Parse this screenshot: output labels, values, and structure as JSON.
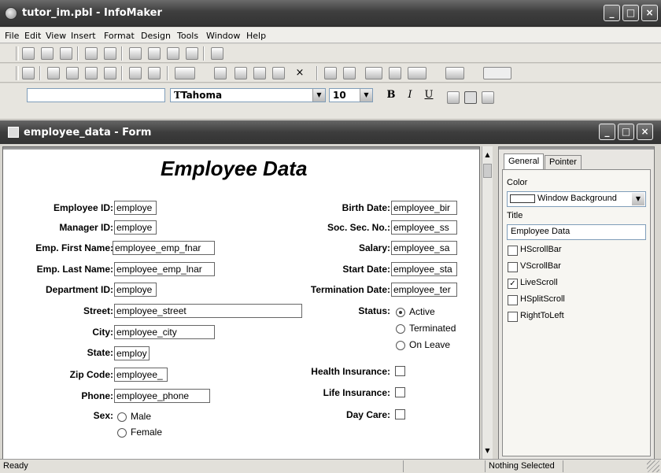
{
  "app": {
    "title": "tutor_im.pbl - InfoMaker"
  },
  "menu": [
    "File",
    "Edit",
    "View",
    "Insert",
    "Format",
    "Design",
    "Tools",
    "Window",
    "Help"
  ],
  "toolbar": {
    "font": "Tahoma",
    "font_icon": "T",
    "size": "10",
    "bold": "B",
    "italic": "I",
    "underline": "U",
    "close_x": "×"
  },
  "child": {
    "title": "employee_data - Form"
  },
  "form": {
    "heading": "Employee Data",
    "left": [
      {
        "label": "Employee ID:",
        "value": "employe"
      },
      {
        "label": "Manager ID:",
        "value": "employe"
      },
      {
        "label": "Emp. First Name:",
        "value": "employee_emp_fnar"
      },
      {
        "label": "Emp. Last Name:",
        "value": "employee_emp_lnar"
      },
      {
        "label": "Department ID:",
        "value": "employe"
      },
      {
        "label": "Street:",
        "value": "employee_street"
      },
      {
        "label": "City:",
        "value": "employee_city"
      },
      {
        "label": "State:",
        "value": "employ"
      },
      {
        "label": "Zip Code:",
        "value": "employee_"
      },
      {
        "label": "Phone:",
        "value": "employee_phone"
      }
    ],
    "sex_label": "Sex:",
    "sex_options": [
      "Male",
      "Female"
    ],
    "right": [
      {
        "label": "Birth Date:",
        "value": "employee_bir"
      },
      {
        "label": "Soc. Sec. No.:",
        "value": "employee_ss"
      },
      {
        "label": "Salary:",
        "value": "employee_sa"
      },
      {
        "label": "Start Date:",
        "value": "employee_sta"
      },
      {
        "label": "Termination Date:",
        "value": "employee_ter"
      }
    ],
    "status_label": "Status:",
    "status_options": [
      "Active",
      "Terminated",
      "On Leave"
    ],
    "checks": [
      "Health Insurance:",
      "Life Insurance:",
      "Day Care:"
    ]
  },
  "props": {
    "tabs": [
      "General",
      "Pointer"
    ],
    "color_label": "Color",
    "color_value": "Window Background",
    "title_label": "Title",
    "title_value": "Employee Data",
    "options": [
      {
        "label": "HScrollBar",
        "checked": false
      },
      {
        "label": "VScrollBar",
        "checked": false
      },
      {
        "label": "LiveScroll",
        "checked": true
      },
      {
        "label": "HSplitScroll",
        "checked": false
      },
      {
        "label": "RightToLeft",
        "checked": false
      }
    ]
  },
  "status": {
    "left": "Ready",
    "right": "Nothing Selected"
  }
}
